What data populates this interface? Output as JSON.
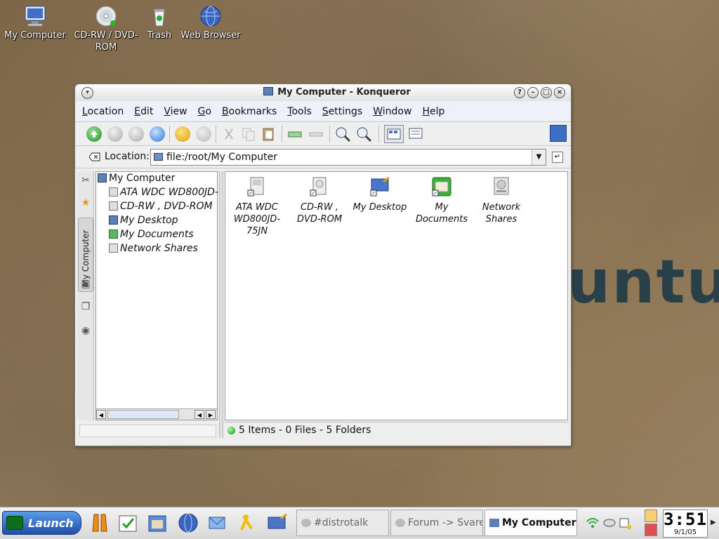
{
  "desktop": {
    "wallpaper_text": "untu",
    "icons": [
      {
        "label": "My Computer",
        "icon": "computer-icon"
      },
      {
        "label": "CD-RW / DVD-ROM",
        "icon": "cdrom-icon"
      },
      {
        "label": "Trash",
        "icon": "trash-icon"
      },
      {
        "label": "Web Browser",
        "icon": "globe-icon"
      }
    ]
  },
  "window": {
    "title": "My Computer - Konqueror",
    "menu": [
      "Location",
      "Edit",
      "View",
      "Go",
      "Bookmarks",
      "Tools",
      "Settings",
      "Window",
      "Help"
    ],
    "location_label": "Location:",
    "location_value": "file:/root/My Computer",
    "tree": {
      "root": "My Computer",
      "items": [
        "ATA WDC WD800JD-",
        "CD-RW , DVD-ROM",
        "My Desktop",
        "My Documents",
        "Network Shares"
      ]
    },
    "sidetab_label": "My Computer",
    "files": [
      {
        "label": "ATA WDC WD800JD-75JN",
        "icon": "harddisk-icon"
      },
      {
        "label": "CD-RW , DVD-ROM",
        "icon": "cdrom-drive-icon"
      },
      {
        "label": "My Desktop",
        "icon": "desktop-icon"
      },
      {
        "label": "My Documents",
        "icon": "documents-icon"
      },
      {
        "label": "Network Shares",
        "icon": "network-drive-icon"
      }
    ],
    "status": "5 Items - 0 Files - 5 Folders"
  },
  "taskbar": {
    "launch_label": "Launch",
    "tasks": [
      {
        "label": "#distrotalk",
        "active": false
      },
      {
        "label": "Forum -> Svarer",
        "active": false
      },
      {
        "label": "My Computer -",
        "active": true
      }
    ],
    "clock_time": "3:51",
    "clock_date": "9/1/05"
  },
  "colors": {
    "accent": "#1f4fa8",
    "wallpaper": "#8a7458",
    "status_ok": "#1a8a1a"
  }
}
